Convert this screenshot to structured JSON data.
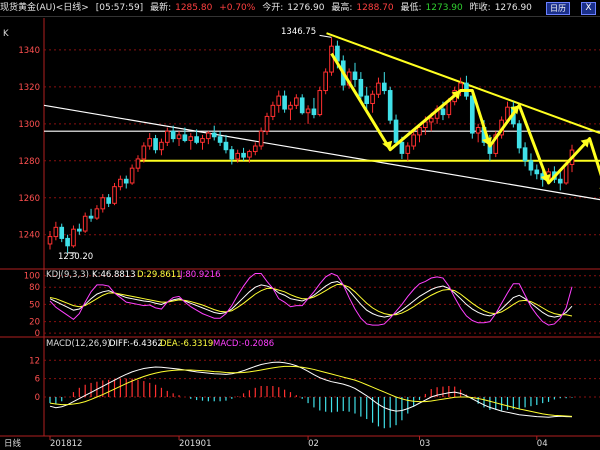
{
  "header": {
    "instrument": "现货黄金(AU)<日线>",
    "time": "[05:57:59]",
    "latest_label": "最新:",
    "latest_value": "1285.80",
    "change": "+0.70%",
    "open_label": "今开:",
    "open_value": "1276.90",
    "high_label": "最高:",
    "high_value": "1288.70",
    "low_label": "最低:",
    "low_value": "1273.90",
    "prev_label": "昨收:",
    "prev_value": "1276.90",
    "info_button": "日历",
    "close_button": "X"
  },
  "price_panel": {
    "corner_label": "K",
    "high_annotation": "1346.75",
    "low_annotation": "1230.20"
  },
  "kdj_panel": {
    "title": "KDJ(9,3,3)",
    "k": "K:46.8813",
    "d": "D:29.8611",
    "j": "J:80.9216"
  },
  "macd_panel": {
    "title": "MACD(12,26,9)",
    "diff": "DIFF:-6.4362",
    "dea": "DEA:-6.3319",
    "macd": "MACD:-0.2086"
  },
  "bottom_axis": {
    "period_label": "日线",
    "ticks": [
      "201812",
      "201901",
      "02",
      "03",
      "04"
    ]
  },
  "colors": {
    "up": "#ff3030",
    "down": "#40e0e8",
    "trend_yellow": "#ffff20",
    "grid": "#8a1010",
    "macd_fast": "#ffffff",
    "macd_slow": "#ffff30",
    "kdj_j": "#ff40ff"
  },
  "chart_data": [
    {
      "type": "candlestick",
      "x_ticks": [
        "201812",
        "201901",
        "02",
        "03",
        "04"
      ],
      "y_ticks": [
        1240,
        1260,
        1280,
        1300,
        1320,
        1340
      ],
      "ylim": [
        1222,
        1354
      ],
      "annotations": [
        {
          "text": "1346.75",
          "value": 1346.75
        },
        {
          "text": "1230.20",
          "value": 1230.2
        }
      ],
      "candles": [
        [
          1235,
          1242,
          1232,
          1239
        ],
        [
          1239,
          1247,
          1237,
          1244
        ],
        [
          1244,
          1246,
          1236,
          1238
        ],
        [
          1238,
          1240,
          1230.2,
          1234
        ],
        [
          1234,
          1245,
          1233,
          1243
        ],
        [
          1243,
          1246,
          1240,
          1242
        ],
        [
          1242,
          1252,
          1241,
          1250
        ],
        [
          1250,
          1254,
          1247,
          1249
        ],
        [
          1249,
          1256,
          1248,
          1254
        ],
        [
          1254,
          1262,
          1252,
          1260
        ],
        [
          1260,
          1262,
          1255,
          1257
        ],
        [
          1257,
          1268,
          1256,
          1266
        ],
        [
          1266,
          1272,
          1264,
          1270
        ],
        [
          1270,
          1272,
          1265,
          1268
        ],
        [
          1268,
          1278,
          1267,
          1276
        ],
        [
          1276,
          1283,
          1274,
          1281
        ],
        [
          1281,
          1290,
          1279,
          1288
        ],
        [
          1288,
          1295,
          1286,
          1292
        ],
        [
          1292,
          1294,
          1284,
          1286
        ],
        [
          1286,
          1292,
          1283,
          1290
        ],
        [
          1290,
          1298,
          1288,
          1296
        ],
        [
          1296,
          1299,
          1290,
          1292
        ],
        [
          1292,
          1296,
          1288,
          1294
        ],
        [
          1294,
          1298,
          1290,
          1291
        ],
        [
          1291,
          1295,
          1286,
          1293
        ],
        [
          1293,
          1297,
          1289,
          1290
        ],
        [
          1290,
          1294,
          1286,
          1292
        ],
        [
          1292,
          1296,
          1289,
          1295
        ],
        [
          1295,
          1299,
          1291,
          1293
        ],
        [
          1293,
          1296,
          1288,
          1290
        ],
        [
          1290,
          1294,
          1284,
          1286
        ],
        [
          1286,
          1288,
          1278,
          1281
        ],
        [
          1281,
          1286,
          1279,
          1284
        ],
        [
          1284,
          1287,
          1280,
          1282
        ],
        [
          1282,
          1286,
          1279,
          1285
        ],
        [
          1285,
          1290,
          1283,
          1288
        ],
        [
          1288,
          1298,
          1286,
          1296
        ],
        [
          1296,
          1306,
          1294,
          1304
        ],
        [
          1304,
          1312,
          1302,
          1310
        ],
        [
          1310,
          1318,
          1306,
          1315
        ],
        [
          1315,
          1318,
          1306,
          1308
        ],
        [
          1308,
          1312,
          1302,
          1310
        ],
        [
          1310,
          1316,
          1308,
          1314
        ],
        [
          1314,
          1316,
          1305,
          1306
        ],
        [
          1306,
          1310,
          1300,
          1308
        ],
        [
          1308,
          1314,
          1303,
          1305
        ],
        [
          1305,
          1320,
          1304,
          1318
        ],
        [
          1318,
          1330,
          1316,
          1328
        ],
        [
          1328,
          1346.75,
          1326,
          1342
        ],
        [
          1342,
          1345,
          1330,
          1334
        ],
        [
          1334,
          1337,
          1318,
          1321
        ],
        [
          1321,
          1330,
          1319,
          1328
        ],
        [
          1328,
          1333,
          1320,
          1324
        ],
        [
          1324,
          1328,
          1312,
          1315
        ],
        [
          1315,
          1320,
          1308,
          1311
        ],
        [
          1311,
          1318,
          1306,
          1316
        ],
        [
          1316,
          1325,
          1314,
          1322
        ],
        [
          1322,
          1328,
          1316,
          1318
        ],
        [
          1318,
          1320,
          1300,
          1302
        ],
        [
          1302,
          1305,
          1288,
          1290
        ],
        [
          1290,
          1293,
          1281,
          1284
        ],
        [
          1284,
          1290,
          1280,
          1288
        ],
        [
          1288,
          1296,
          1286,
          1294
        ],
        [
          1294,
          1300,
          1290,
          1298
        ],
        [
          1298,
          1304,
          1294,
          1301
        ],
        [
          1301,
          1306,
          1296,
          1303
        ],
        [
          1303,
          1310,
          1300,
          1308
        ],
        [
          1308,
          1312,
          1302,
          1305
        ],
        [
          1305,
          1314,
          1303,
          1312
        ],
        [
          1312,
          1320,
          1310,
          1318
        ],
        [
          1318,
          1325,
          1315,
          1322
        ],
        [
          1322,
          1326,
          1313,
          1315
        ],
        [
          1315,
          1318,
          1292,
          1295
        ],
        [
          1295,
          1300,
          1290,
          1298
        ],
        [
          1298,
          1302,
          1288,
          1290
        ],
        [
          1290,
          1294,
          1280,
          1284
        ],
        [
          1284,
          1296,
          1282,
          1294
        ],
        [
          1294,
          1304,
          1292,
          1302
        ],
        [
          1302,
          1312,
          1300,
          1309
        ],
        [
          1309,
          1312,
          1298,
          1300
        ],
        [
          1300,
          1302,
          1284,
          1287
        ],
        [
          1287,
          1290,
          1277,
          1280
        ],
        [
          1280,
          1284,
          1272,
          1275
        ],
        [
          1275,
          1278,
          1270,
          1273
        ],
        [
          1273,
          1276,
          1266,
          1270
        ],
        [
          1270,
          1276,
          1268,
          1274
        ],
        [
          1274,
          1277,
          1268,
          1270
        ],
        [
          1270,
          1274,
          1264,
          1268
        ],
        [
          1268,
          1280,
          1267,
          1278
        ],
        [
          1278,
          1288.7,
          1273.9,
          1285.8
        ]
      ]
    },
    {
      "type": "line",
      "title": "KDJ(9,3,3)",
      "y_ticks": [
        0,
        20,
        50,
        80,
        100
      ],
      "ylim": [
        -5,
        110
      ],
      "series": [
        {
          "name": "K",
          "values": [
            60,
            55,
            50,
            45,
            40,
            42,
            50,
            60,
            68,
            72,
            74,
            70,
            66,
            62,
            60,
            58,
            56,
            55,
            52,
            50,
            54,
            58,
            60,
            56,
            52,
            48,
            44,
            40,
            36,
            34,
            36,
            42,
            52,
            62,
            72,
            80,
            84,
            82,
            78,
            70,
            66,
            60,
            58,
            56,
            60,
            66,
            74,
            82,
            88,
            90,
            84,
            74,
            62,
            50,
            40,
            34,
            30,
            28,
            30,
            34,
            40,
            48,
            56,
            64,
            70,
            76,
            80,
            82,
            78,
            70,
            60,
            50,
            42,
            36,
            32,
            30,
            34,
            42,
            52,
            62,
            66,
            60,
            52,
            44,
            36,
            30,
            28,
            30,
            36,
            46.9
          ]
        },
        {
          "name": "D",
          "values": [
            62,
            60,
            56,
            52,
            48,
            46,
            48,
            54,
            60,
            66,
            70,
            70,
            68,
            66,
            64,
            62,
            60,
            58,
            56,
            54,
            54,
            56,
            58,
            57,
            55,
            52,
            49,
            45,
            41,
            38,
            37,
            39,
            45,
            52,
            60,
            68,
            74,
            78,
            78,
            75,
            72,
            67,
            63,
            60,
            60,
            63,
            68,
            74,
            80,
            85,
            84,
            80,
            72,
            62,
            52,
            44,
            38,
            34,
            32,
            32,
            35,
            40,
            46,
            53,
            60,
            66,
            71,
            75,
            76,
            74,
            68,
            60,
            52,
            45,
            39,
            35,
            34,
            37,
            43,
            50,
            56,
            57,
            55,
            50,
            44,
            38,
            34,
            32,
            32,
            29.9
          ]
        },
        {
          "name": "J",
          "values": [
            56,
            45,
            38,
            31,
            24,
            34,
            54,
            72,
            84,
            84,
            82,
            70,
            62,
            54,
            52,
            50,
            48,
            49,
            44,
            42,
            54,
            62,
            64,
            54,
            46,
            40,
            34,
            30,
            26,
            26,
            34,
            48,
            66,
            82,
            96,
            104,
            104,
            90,
            78,
            60,
            54,
            46,
            48,
            48,
            60,
            72,
            86,
            98,
            104,
            100,
            84,
            62,
            42,
            26,
            16,
            14,
            14,
            16,
            26,
            38,
            50,
            64,
            76,
            86,
            90,
            96,
            98,
            96,
            82,
            62,
            44,
            30,
            22,
            18,
            18,
            20,
            34,
            52,
            70,
            86,
            86,
            66,
            46,
            32,
            20,
            14,
            16,
            26,
            44,
            80.9
          ]
        }
      ]
    },
    {
      "type": "bar+line",
      "title": "MACD(12,26,9)",
      "y_ticks": [
        0,
        6,
        12
      ],
      "ylim": [
        -16,
        16
      ],
      "series": [
        {
          "name": "DIFF",
          "values": [
            -3,
            -3.5,
            -3.2,
            -2.5,
            -1.5,
            -0.5,
            0.5,
            1.5,
            2.5,
            3.5,
            4.5,
            5.5,
            6.5,
            7.4,
            8.2,
            8.8,
            9.3,
            9.6,
            9.8,
            9.7,
            9.5,
            9.3,
            9.1,
            8.8,
            8.5,
            8.2,
            8,
            7.8,
            7.6,
            7.5,
            7.4,
            7.6,
            8,
            8.6,
            9.3,
            10,
            10.6,
            11,
            11.3,
            11.4,
            11.2,
            10.8,
            10.2,
            9.4,
            8.4,
            7.3,
            6.3,
            5.6,
            5,
            4.6,
            4.2,
            3.6,
            2.8,
            1.6,
            0.4,
            -1,
            -2.4,
            -3.5,
            -4.2,
            -4.6,
            -4.4,
            -3.8,
            -3,
            -2,
            -1,
            0,
            0.6,
            1,
            1.4,
            1.6,
            1.2,
            0.4,
            -0.6,
            -1.6,
            -2.6,
            -3.4,
            -4,
            -4.6,
            -5,
            -5.4,
            -5.8,
            -6,
            -6.2,
            -6.4,
            -6.5,
            -6.6,
            -6.4,
            -6.3,
            -6.4,
            -6.44
          ]
        },
        {
          "name": "DEA",
          "values": [
            -2,
            -2.3,
            -2.5,
            -2.5,
            -2.3,
            -2,
            -1.5,
            -0.8,
            0,
            0.8,
            1.7,
            2.6,
            3.5,
            4.4,
            5.2,
            6,
            6.7,
            7.3,
            7.8,
            8.2,
            8.5,
            8.7,
            8.8,
            8.8,
            8.8,
            8.7,
            8.6,
            8.5,
            8.3,
            8.2,
            8,
            7.9,
            7.9,
            8,
            8.2,
            8.5,
            8.8,
            9.2,
            9.5,
            9.8,
            10,
            10,
            9.9,
            9.7,
            9.4,
            9,
            8.5,
            8,
            7.5,
            7,
            6.5,
            6,
            5.5,
            4.8,
            4,
            3.2,
            2.4,
            1.6,
            0.8,
            0,
            -0.6,
            -1.1,
            -1.4,
            -1.5,
            -1.5,
            -1.3,
            -1,
            -0.7,
            -0.4,
            -0.1,
            0,
            0,
            -0.2,
            -0.5,
            -0.9,
            -1.4,
            -1.9,
            -2.4,
            -2.9,
            -3.4,
            -3.9,
            -4.3,
            -4.7,
            -5.1,
            -5.5,
            -5.8,
            -6,
            -6.1,
            -6.2,
            -6.33
          ]
        },
        {
          "name": "MACD",
          "values": [
            -2,
            -2.4,
            -1.4,
            0,
            1.6,
            3,
            4,
            4.6,
            5,
            5.4,
            5.6,
            5.8,
            6,
            6,
            6,
            5.6,
            5.2,
            4.6,
            4,
            3,
            2,
            1.2,
            0.6,
            0,
            -0.6,
            -1,
            -1.2,
            -1.4,
            -1.4,
            -1.4,
            -1.2,
            -0.6,
            0.2,
            1.2,
            2.2,
            3,
            3.6,
            3.6,
            3.6,
            3.2,
            2.4,
            1.6,
            0.6,
            -0.6,
            -2,
            -3.4,
            -4.4,
            -4.8,
            -5,
            -4.8,
            -4.6,
            -4.8,
            -5.4,
            -6.4,
            -7.2,
            -8.4,
            -9.6,
            -10.2,
            -10,
            -9.2,
            -7.6,
            -5.4,
            -3.2,
            -1,
            1,
            2.6,
            3.2,
            3.4,
            3.6,
            3.4,
            2.4,
            0.8,
            -0.8,
            -2.2,
            -3.4,
            -4.2,
            -4.2,
            -4.4,
            -4.2,
            -4,
            -3.8,
            -3.4,
            -3,
            -2.6,
            -2,
            -1.6,
            -0.8,
            -0.4,
            -0.4,
            -0.21
          ]
        }
      ]
    }
  ]
}
